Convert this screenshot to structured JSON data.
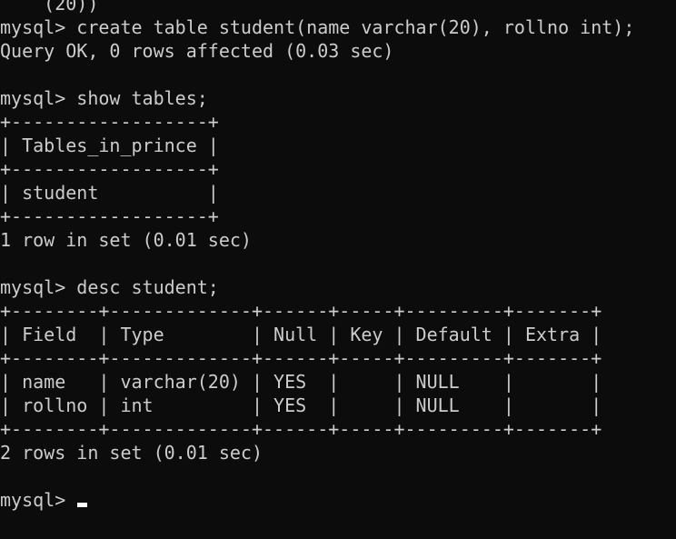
{
  "terminal": {
    "lines": [
      "    (20))",
      "mysql> create table student(name varchar(20), rollno int);",
      "Query OK, 0 rows affected (0.03 sec)",
      "",
      "mysql> show tables;",
      "+------------------+",
      "| Tables_in_prince |",
      "+------------------+",
      "| student          |",
      "+------------------+",
      "1 row in set (0.01 sec)",
      "",
      "mysql> desc student;",
      "+--------+-------------+------+-----+---------+-------+",
      "| Field  | Type        | Null | Key | Default | Extra |",
      "+--------+-------------+------+-----+---------+-------+",
      "| name   | varchar(20) | YES  |     | NULL    |       |",
      "| rollno | int         | YES  |     | NULL    |       |",
      "+--------+-------------+------+-----+---------+-------+",
      "2 rows in set (0.01 sec)",
      ""
    ],
    "prompt": "mysql> "
  },
  "colors": {
    "background": "#0c0c0c",
    "foreground": "#cccccc",
    "cursor": "#ffffff"
  }
}
